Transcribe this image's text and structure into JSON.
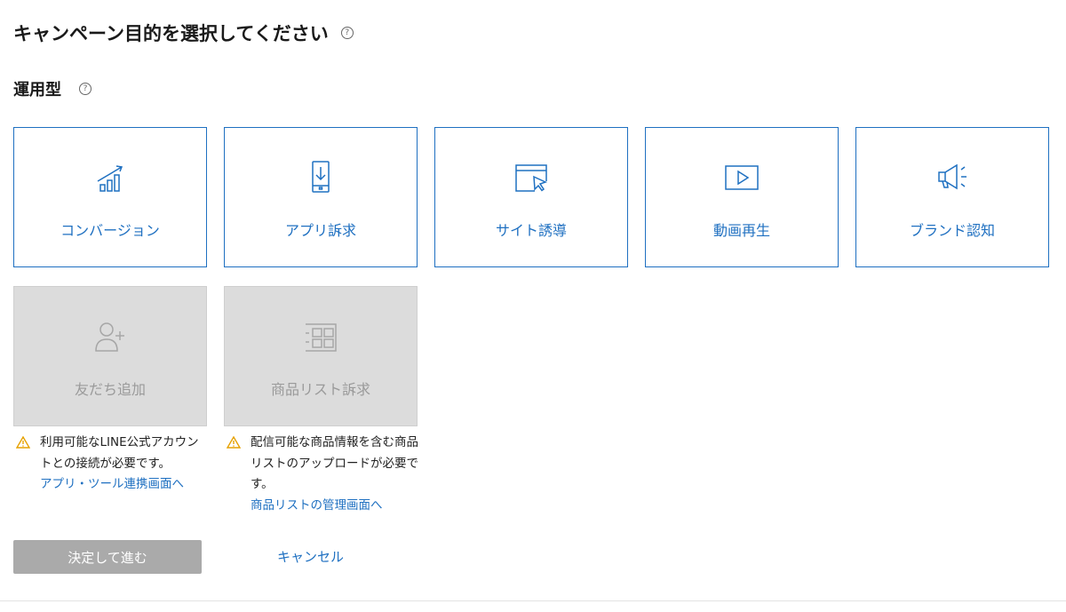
{
  "header": {
    "title": "キャンペーン目的を選択してください",
    "help_glyph": "?"
  },
  "section": {
    "title": "運用型",
    "help_glyph": "?"
  },
  "objectives": [
    {
      "label": "コンバージョン",
      "icon": "chart-growth-icon",
      "enabled": true
    },
    {
      "label": "アプリ訴求",
      "icon": "smartphone-download-icon",
      "enabled": true
    },
    {
      "label": "サイト誘導",
      "icon": "browser-cursor-icon",
      "enabled": true
    },
    {
      "label": "動画再生",
      "icon": "video-play-icon",
      "enabled": true
    },
    {
      "label": "ブランド認知",
      "icon": "megaphone-icon",
      "enabled": true
    },
    {
      "label": "友だち追加",
      "icon": "add-user-icon",
      "enabled": false
    },
    {
      "label": "商品リスト訴求",
      "icon": "product-grid-icon",
      "enabled": false
    }
  ],
  "notes": {
    "friends": {
      "text": "利用可能なLINE公式アカウントとの接続が必要です。",
      "link": "アプリ・ツール連携画面へ"
    },
    "products": {
      "text": "配信可能な商品情報を含む商品リストのアップロードが必要です。",
      "link": "商品リストの管理画面へ"
    }
  },
  "actions": {
    "submit_label": "決定して進む",
    "cancel_label": "キャンセル"
  },
  "colors": {
    "accent": "#1f70c1",
    "disabled_bg": "#dcdcdc",
    "disabled_text": "#9a9a9a",
    "warning": "#e6a100",
    "submit_disabled": "#aaaaaa"
  }
}
